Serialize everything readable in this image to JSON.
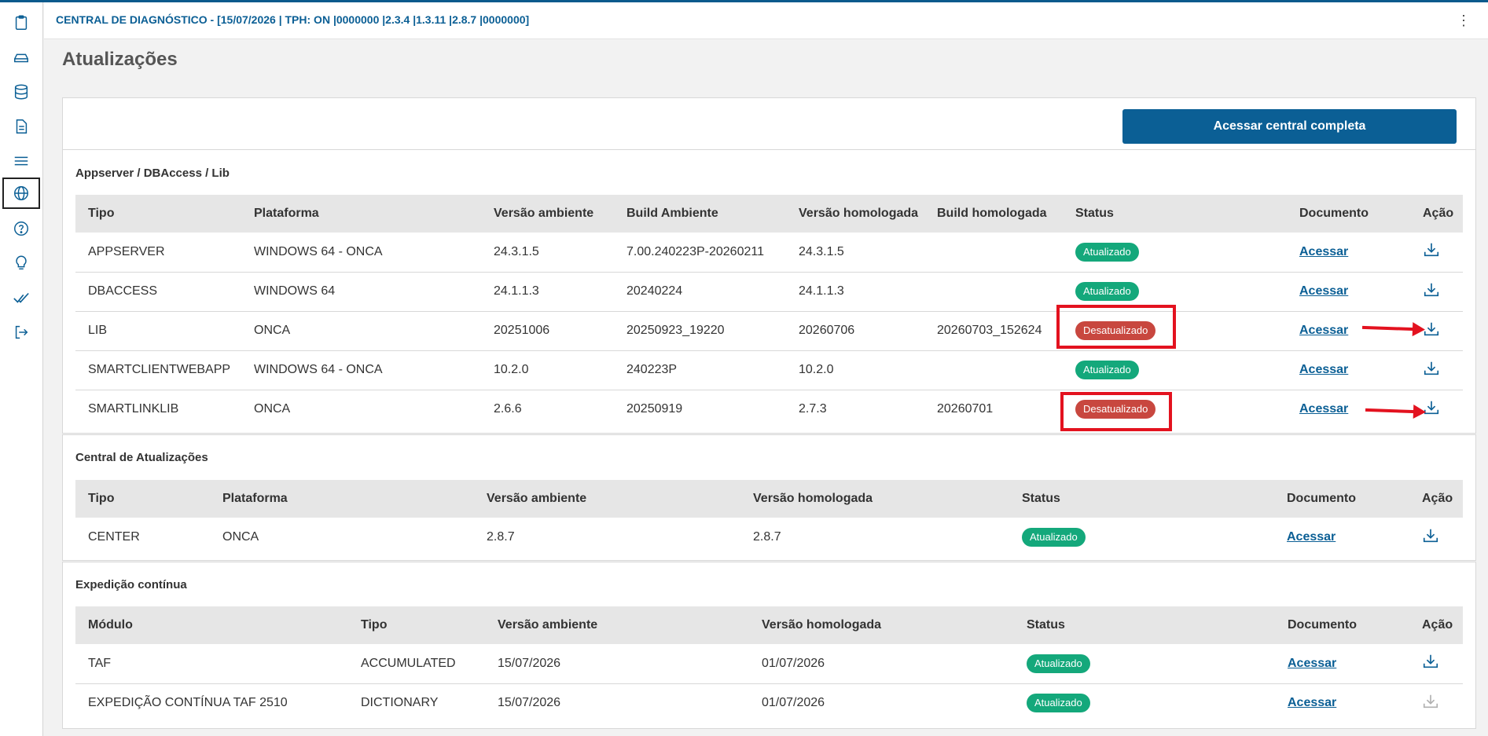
{
  "header": {
    "title": "CENTRAL DE DIAGNÓSTICO - [15/07/2026 | TPH: ON |0000000 |2.3.4 |1.3.11 |2.8.7 |0000000]",
    "menu_glyph": "⋮"
  },
  "page": {
    "title": "Atualizações"
  },
  "top_panel": {
    "button_label": "Acessar central completa"
  },
  "colors": {
    "accent": "#0b5f95",
    "ok": "#14a87b",
    "bad": "#c8473f",
    "highlight": "#e3121f"
  },
  "icons": {
    "sidebar": [
      "clipboard-icon",
      "drive-icon",
      "database-icon",
      "document-icon",
      "list-icon",
      "globe-icon",
      "help-icon",
      "lightbulb-icon",
      "check-icon",
      "logout-icon"
    ],
    "action": "download-icon"
  },
  "appserver": {
    "title": "Appserver / DBAccess / Lib",
    "headers": [
      "Tipo",
      "Plataforma",
      "Versão ambiente",
      "Build Ambiente",
      "Versão homologada",
      "Build homologada",
      "Status",
      "Documento",
      "Ação"
    ],
    "rows": [
      {
        "tipo": "APPSERVER",
        "plataforma": "WINDOWS 64 - ONCA",
        "versao_ambiente": "24.3.1.5",
        "build_ambiente": "7.00.240223P-20260211",
        "versao_homologada": "24.3.1.5",
        "build_homologada": "",
        "status": "Atualizado",
        "documento": "Acessar"
      },
      {
        "tipo": "DBACCESS",
        "plataforma": "WINDOWS 64",
        "versao_ambiente": "24.1.1.3",
        "build_ambiente": "20240224",
        "versao_homologada": "24.1.1.3",
        "build_homologada": "",
        "status": "Atualizado",
        "documento": "Acessar"
      },
      {
        "tipo": "LIB",
        "plataforma": "ONCA",
        "versao_ambiente": "20251006",
        "build_ambiente": "20250923_19220",
        "versao_homologada": "20260706",
        "build_homologada": "20260703_152624",
        "status": "Desatualizado",
        "documento": "Acessar"
      },
      {
        "tipo": "SMARTCLIENTWEBAPP",
        "plataforma": "WINDOWS 64 - ONCA",
        "versao_ambiente": "10.2.0",
        "build_ambiente": "240223P",
        "versao_homologada": "10.2.0",
        "build_homologada": "",
        "status": "Atualizado",
        "documento": "Acessar"
      },
      {
        "tipo": "SMARTLINKLIB",
        "plataforma": "ONCA",
        "versao_ambiente": "2.6.6",
        "build_ambiente": "20250919",
        "versao_homologada": "2.7.3",
        "build_homologada": "20260701",
        "status": "Desatualizado",
        "documento": "Acessar"
      }
    ]
  },
  "central": {
    "title": "Central de Atualizações",
    "headers": [
      "Tipo",
      "Plataforma",
      "Versão ambiente",
      "Versão homologada",
      "Status",
      "Documento",
      "Ação"
    ],
    "rows": [
      {
        "tipo": "CENTER",
        "plataforma": "ONCA",
        "versao_ambiente": "2.8.7",
        "versao_homologada": "2.8.7",
        "status": "Atualizado",
        "documento": "Acessar"
      }
    ]
  },
  "expedicao": {
    "title": "Expedição contínua",
    "headers": [
      "Módulo",
      "Tipo",
      "Versão ambiente",
      "Versão homologada",
      "Status",
      "Documento",
      "Ação"
    ],
    "rows": [
      {
        "modulo": "TAF",
        "tipo": "ACCUMULATED",
        "versao_ambiente": "15/07/2026",
        "versao_homologada": "01/07/2026",
        "status": "Atualizado",
        "documento": "Acessar"
      },
      {
        "modulo": "EXPEDIÇÃO CONTÍNUA TAF 2510",
        "tipo": "DICTIONARY",
        "versao_ambiente": "15/07/2026",
        "versao_homologada": "01/07/2026",
        "status": "Atualizado",
        "documento": "Acessar"
      }
    ]
  }
}
